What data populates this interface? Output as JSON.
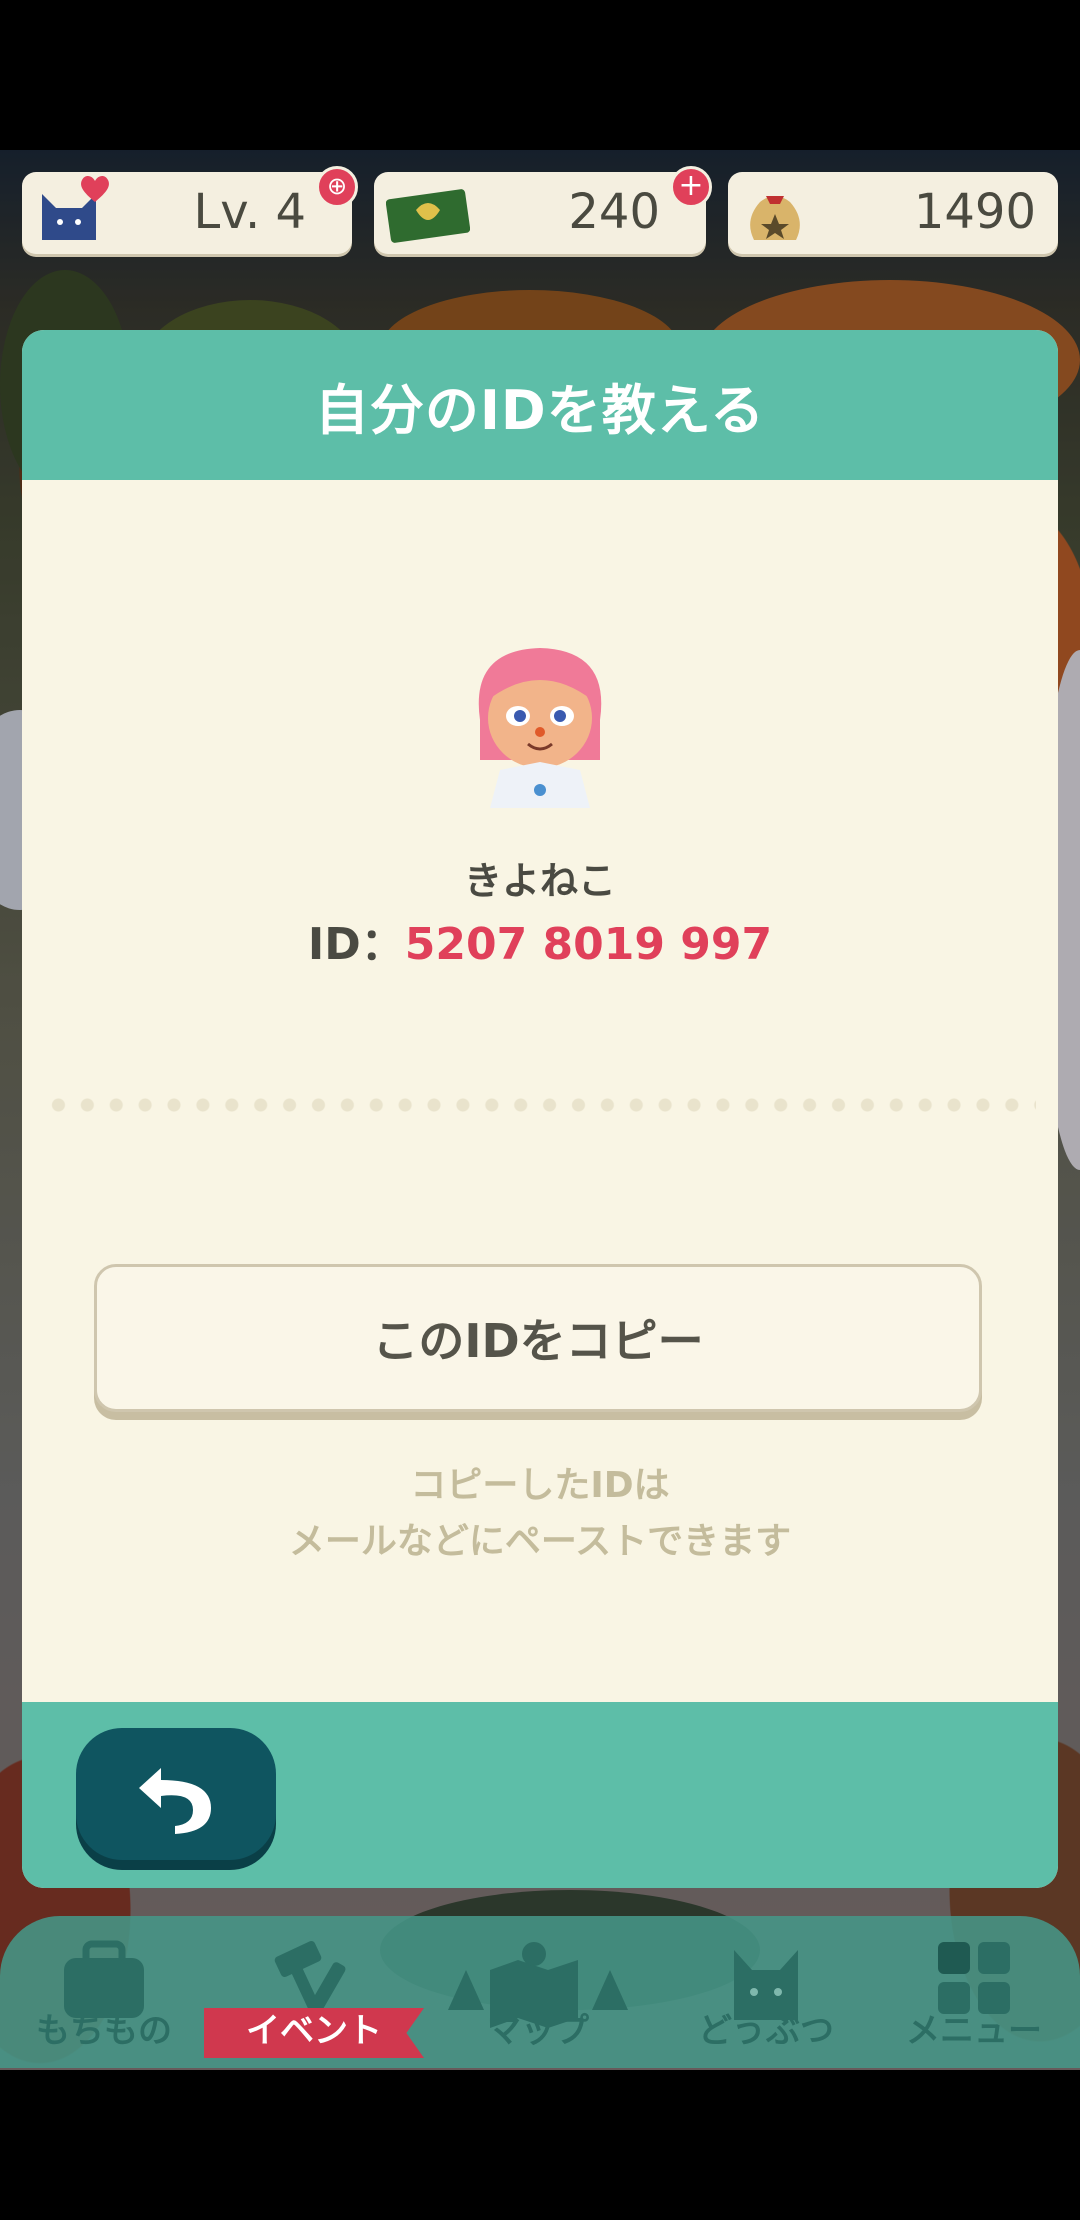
{
  "hud": {
    "level_text": "Lv. 4",
    "tickets": "240",
    "bells": "1490"
  },
  "dialog": {
    "title": "自分のIDを教える",
    "player_name": "きよねこ",
    "id_label": "ID：",
    "id_value": "5207 8019 997",
    "copy_button_label": "このIDをコピー",
    "hint_line1": "コピーしたIDは",
    "hint_line2": "メールなどにペーストできます"
  },
  "nav": {
    "items": [
      {
        "label": "もちもの",
        "icon": "bag-icon"
      },
      {
        "label": "イベント",
        "icon": "hammer-icon",
        "active": true
      },
      {
        "label": "マップ",
        "icon": "map-icon"
      },
      {
        "label": "どうぶつ",
        "icon": "cat-icon"
      },
      {
        "label": "メニュー",
        "icon": "grid-icon"
      }
    ]
  },
  "colors": {
    "accent": "#5dbea8",
    "id_highlight": "#e0405a",
    "back_button": "#0f5560"
  }
}
